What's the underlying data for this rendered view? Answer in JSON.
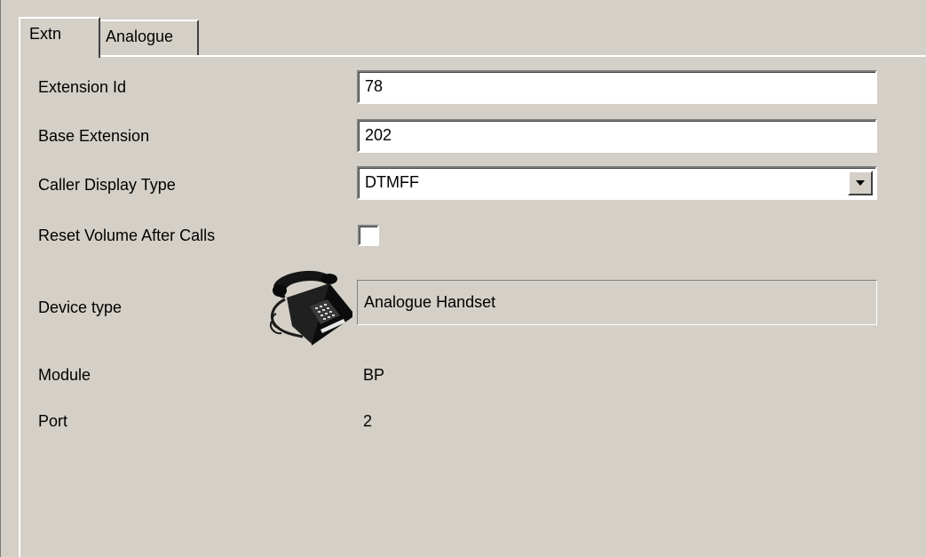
{
  "tabs": [
    {
      "label": "Extn",
      "active": true
    },
    {
      "label": "Analogue",
      "active": false
    }
  ],
  "form": {
    "extension_id": {
      "label": "Extension Id",
      "value": "78"
    },
    "base_extension": {
      "label": "Base Extension",
      "value": "202"
    },
    "caller_display_type": {
      "label": "Caller Display Type",
      "value": "DTMFF"
    },
    "reset_volume": {
      "label": "Reset Volume After Calls",
      "checked": false
    },
    "device_type": {
      "label": "Device type",
      "value": "Analogue Handset",
      "icon": "telephone-icon"
    },
    "module": {
      "label": "Module",
      "value": "BP"
    },
    "port": {
      "label": "Port",
      "value": "2"
    }
  },
  "colors": {
    "face": "#d4d0c8",
    "highlight": "#ffffff",
    "shadow": "#808080"
  }
}
